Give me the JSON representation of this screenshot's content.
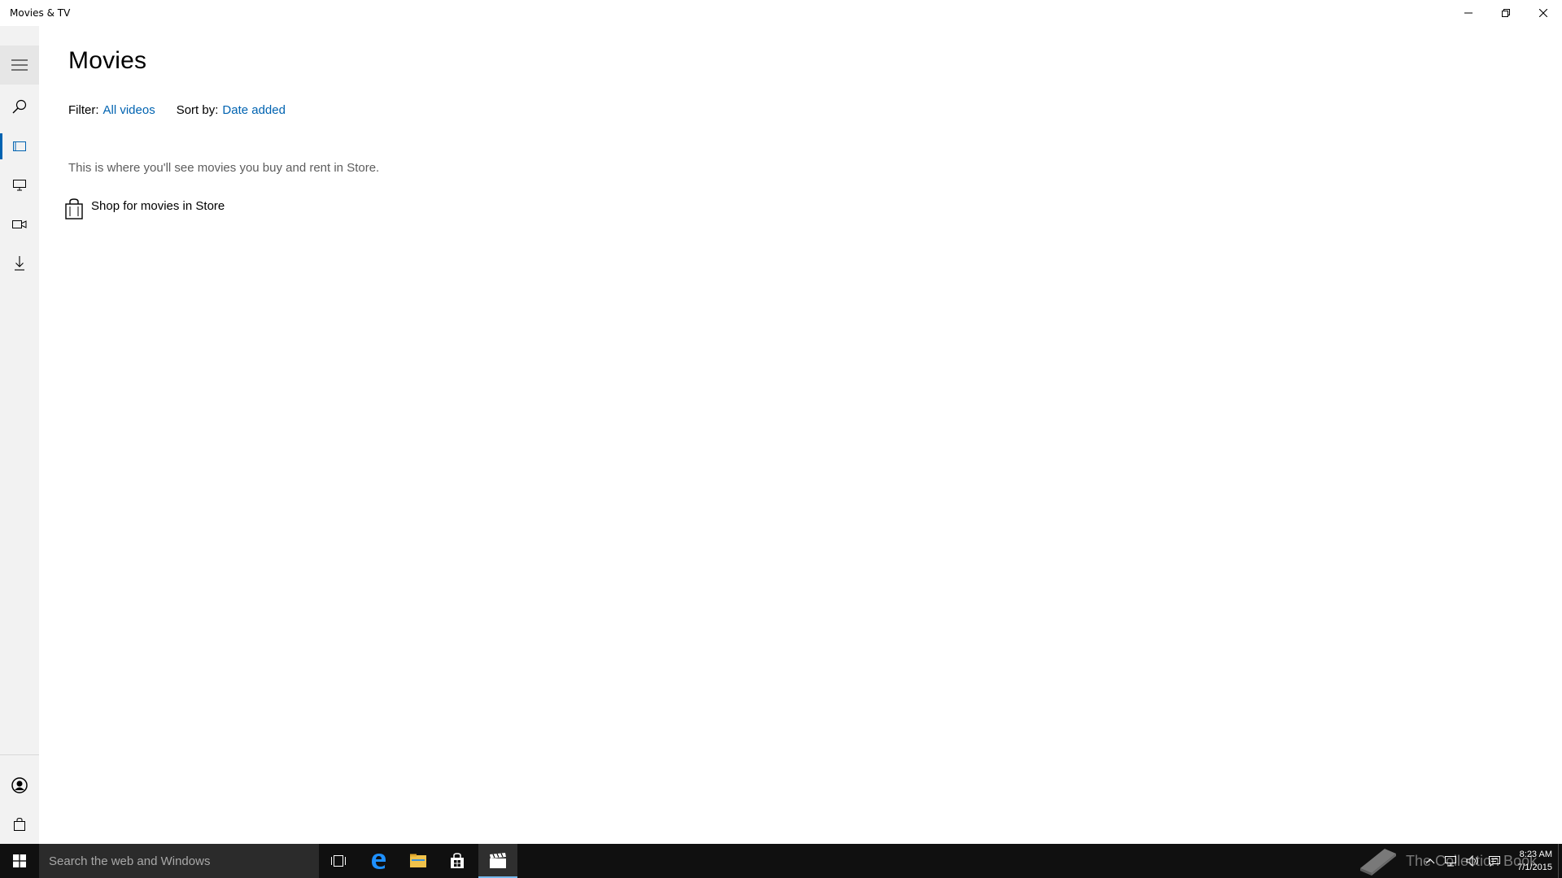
{
  "window": {
    "title": "Movies & TV",
    "controls": {
      "minimize": "minimize-icon",
      "maximize": "restore-icon",
      "close": "close-icon"
    }
  },
  "sidebar": {
    "accent": "#0063b1",
    "items": [
      {
        "name": "hamburger",
        "icon": "hamburger-icon"
      },
      {
        "name": "search",
        "icon": "search-icon"
      },
      {
        "name": "movies",
        "icon": "film-icon",
        "active": true
      },
      {
        "name": "tv",
        "icon": "tv-icon"
      },
      {
        "name": "videos",
        "icon": "video-camera-icon"
      },
      {
        "name": "downloads",
        "icon": "download-icon"
      }
    ],
    "bottom": [
      {
        "name": "account",
        "icon": "account-icon"
      },
      {
        "name": "store",
        "icon": "shopping-bag-icon"
      }
    ]
  },
  "main": {
    "title": "Movies",
    "filter": {
      "label": "Filter:",
      "value": "All videos"
    },
    "sort": {
      "label": "Sort by:",
      "value": "Date added"
    },
    "empty_message": "This is where you'll see movies you buy and rent in Store.",
    "shop_link": "Shop for movies in Store"
  },
  "taskbar": {
    "search_placeholder": "Search the web and Windows",
    "apps": [
      "task-view-icon",
      "edge-icon",
      "file-explorer-icon",
      "store-icon",
      "movies-tv-icon"
    ],
    "watermark": "The Collection Book",
    "clock_time": "8:23 AM",
    "clock_date": "7/1/2015"
  }
}
